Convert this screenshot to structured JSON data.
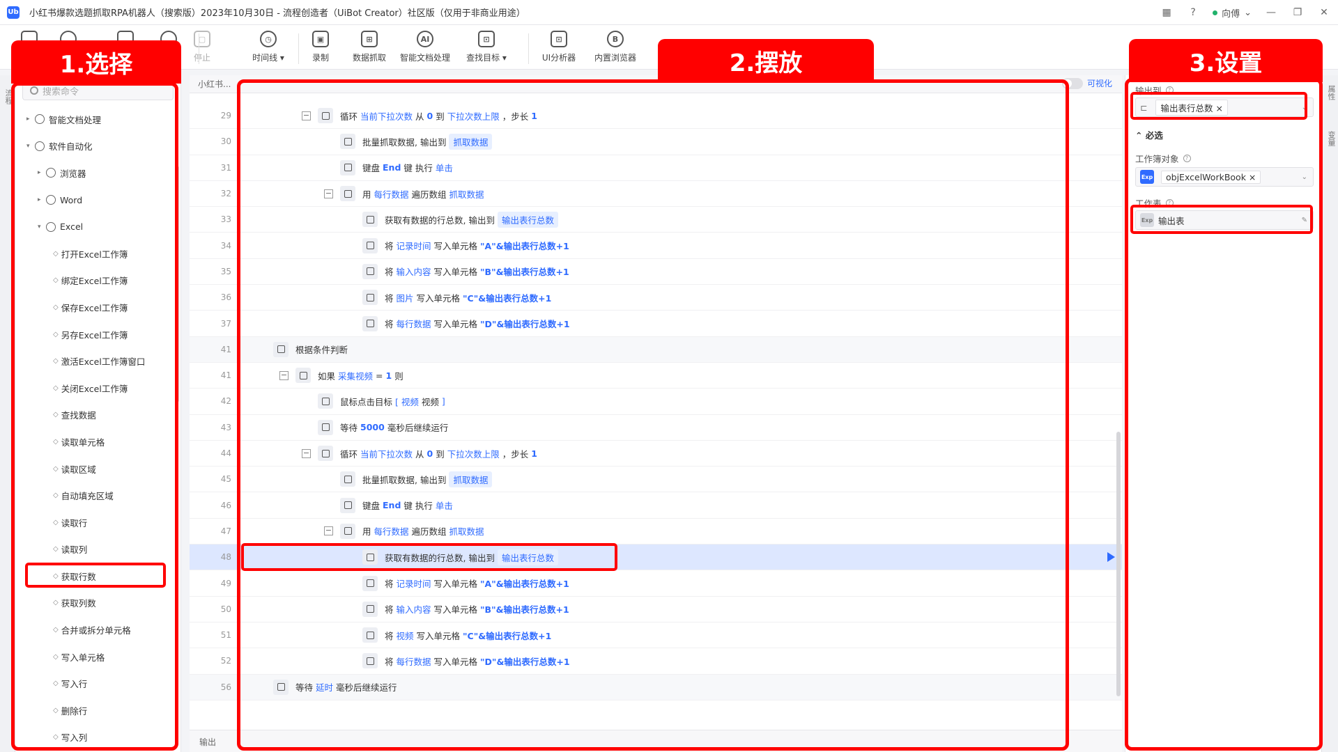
{
  "window": {
    "title": "小红书爆款选题抓取RPA机器人（搜索版）2023年10月30日 - 流程创造者（UiBot Creator）社区版（仅用于非商业用途）",
    "logo": "Ub",
    "user": "向傅"
  },
  "toolbar": {
    "items": [
      {
        "label": "停止",
        "icon": "stop-icon",
        "glyph": "▢",
        "disabled": true
      },
      {
        "label": "时间线 ▾",
        "icon": "clock-icon",
        "glyph": "◷"
      },
      {
        "label": "录制",
        "icon": "record-icon",
        "glyph": "▣"
      },
      {
        "label": "数据抓取",
        "icon": "data-scrape-icon",
        "glyph": "⊞"
      },
      {
        "label": "智能文档处理",
        "icon": "ai-doc-icon",
        "glyph": "AI"
      },
      {
        "label": "查找目标 ▾",
        "icon": "find-target-icon",
        "glyph": "⊡"
      },
      {
        "label": "UI分析器",
        "icon": "ui-analyzer-icon",
        "glyph": "⊡"
      },
      {
        "label": "内置浏览器",
        "icon": "browser-icon",
        "glyph": "B"
      }
    ]
  },
  "left": {
    "search_placeholder": "搜索命令",
    "gutter_label": "流程",
    "items": [
      {
        "label": "智能文档处理",
        "level": 0,
        "arrow": "▸"
      },
      {
        "label": "软件自动化",
        "level": 0,
        "arrow": "▾"
      },
      {
        "label": "浏览器",
        "level": 1,
        "arrow": "▸"
      },
      {
        "label": "Word",
        "level": 1,
        "arrow": "▸"
      },
      {
        "label": "Excel",
        "level": 1,
        "arrow": "▾"
      },
      {
        "label": "打开Excel工作簿",
        "level": 2
      },
      {
        "label": "绑定Excel工作簿",
        "level": 2
      },
      {
        "label": "保存Excel工作簿",
        "level": 2
      },
      {
        "label": "另存Excel工作簿",
        "level": 2
      },
      {
        "label": "激活Excel工作簿窗口",
        "level": 2
      },
      {
        "label": "关闭Excel工作簿",
        "level": 2
      },
      {
        "label": "查找数据",
        "level": 2
      },
      {
        "label": "读取单元格",
        "level": 2
      },
      {
        "label": "读取区域",
        "level": 2
      },
      {
        "label": "自动填充区域",
        "level": 2
      },
      {
        "label": "读取行",
        "level": 2
      },
      {
        "label": "读取列",
        "level": 2
      },
      {
        "label": "获取行数",
        "level": 2
      },
      {
        "label": "获取列数",
        "level": 2
      },
      {
        "label": "合并或拆分单元格",
        "level": 2
      },
      {
        "label": "写入单元格",
        "level": 2
      },
      {
        "label": "写入行",
        "level": 2
      },
      {
        "label": "删除行",
        "level": 2
      },
      {
        "label": "写入列",
        "level": 2
      }
    ]
  },
  "editor": {
    "breadcrumb": "小红书...",
    "visualize_label": "可视化",
    "bottom_tab": "输出",
    "lines": [
      {
        "n": "29",
        "indent": 2,
        "collapse": true,
        "parts": [
          [
            "t",
            "循环 "
          ],
          [
            "kw",
            "当前下拉次数"
          ],
          [
            "t",
            " 从 "
          ],
          [
            "str",
            "0"
          ],
          [
            "t",
            " 到 "
          ],
          [
            "kw",
            "下拉次数上限"
          ],
          [
            "t",
            " ，步长 "
          ],
          [
            "str",
            "1"
          ]
        ]
      },
      {
        "n": "30",
        "indent": 3,
        "parts": [
          [
            "t",
            "批量抓取数据, 输出到 "
          ],
          [
            "pill",
            "抓取数据"
          ]
        ]
      },
      {
        "n": "31",
        "indent": 3,
        "parts": [
          [
            "t",
            "键盘 "
          ],
          [
            "str",
            "End"
          ],
          [
            "t",
            " 键 执行 "
          ],
          [
            "kw",
            "单击"
          ]
        ]
      },
      {
        "n": "32",
        "indent": 3,
        "collapse": true,
        "parts": [
          [
            "t",
            "用 "
          ],
          [
            "kw",
            "每行数据"
          ],
          [
            "t",
            " 遍历数组 "
          ],
          [
            "kw",
            "抓取数据"
          ]
        ]
      },
      {
        "n": "33",
        "indent": 4,
        "parts": [
          [
            "t",
            "获取有数据的行总数, 输出到 "
          ],
          [
            "pill",
            "输出表行总数"
          ]
        ]
      },
      {
        "n": "34",
        "indent": 4,
        "parts": [
          [
            "t",
            "将 "
          ],
          [
            "kw",
            "记录时间"
          ],
          [
            "t",
            " 写入单元格 "
          ],
          [
            "str",
            "\"A\"&输出表行总数+1"
          ]
        ]
      },
      {
        "n": "35",
        "indent": 4,
        "parts": [
          [
            "t",
            "将 "
          ],
          [
            "kw",
            "输入内容"
          ],
          [
            "t",
            " 写入单元格 "
          ],
          [
            "str",
            "\"B\"&输出表行总数+1"
          ]
        ]
      },
      {
        "n": "36",
        "indent": 4,
        "parts": [
          [
            "t",
            "将 "
          ],
          [
            "kw",
            "图片"
          ],
          [
            "t",
            " 写入单元格 "
          ],
          [
            "str",
            "\"C\"&输出表行总数+1"
          ]
        ]
      },
      {
        "n": "37",
        "indent": 4,
        "parts": [
          [
            "t",
            "将 "
          ],
          [
            "kw",
            "每行数据"
          ],
          [
            "t",
            " 写入单元格 "
          ],
          [
            "str",
            "\"D\"&输出表行总数+1"
          ]
        ]
      },
      {
        "n": "41",
        "indent": 0,
        "band": true,
        "parts": [
          [
            "t",
            "根据条件判断"
          ]
        ]
      },
      {
        "n": "41",
        "indent": 1,
        "collapse": true,
        "parts": [
          [
            "t",
            "如果 "
          ],
          [
            "kw",
            "采集视频"
          ],
          [
            "t",
            " = "
          ],
          [
            "str",
            "1"
          ],
          [
            "t",
            " 则"
          ]
        ]
      },
      {
        "n": "42",
        "indent": 2,
        "parts": [
          [
            "t",
            "鼠标点击目标 "
          ],
          [
            "kw",
            "[ 视频"
          ],
          [
            "t",
            "  视频  "
          ],
          [
            "kw",
            "]"
          ]
        ]
      },
      {
        "n": "43",
        "indent": 2,
        "parts": [
          [
            "t",
            "等待 "
          ],
          [
            "str",
            "5000"
          ],
          [
            "t",
            " 毫秒后继续运行"
          ]
        ]
      },
      {
        "n": "44",
        "indent": 2,
        "collapse": true,
        "parts": [
          [
            "t",
            "循环 "
          ],
          [
            "kw",
            "当前下拉次数"
          ],
          [
            "t",
            " 从 "
          ],
          [
            "str",
            "0"
          ],
          [
            "t",
            " 到 "
          ],
          [
            "kw",
            "下拉次数上限"
          ],
          [
            "t",
            " ，步长 "
          ],
          [
            "str",
            "1"
          ]
        ]
      },
      {
        "n": "45",
        "indent": 3,
        "parts": [
          [
            "t",
            "批量抓取数据, 输出到 "
          ],
          [
            "pill",
            "抓取数据"
          ]
        ]
      },
      {
        "n": "46",
        "indent": 3,
        "parts": [
          [
            "t",
            "键盘 "
          ],
          [
            "str",
            "End"
          ],
          [
            "t",
            " 键 执行 "
          ],
          [
            "kw",
            "单击"
          ]
        ]
      },
      {
        "n": "47",
        "indent": 3,
        "collapse": true,
        "parts": [
          [
            "t",
            "用 "
          ],
          [
            "kw",
            "每行数据"
          ],
          [
            "t",
            " 遍历数组 "
          ],
          [
            "kw",
            "抓取数据"
          ]
        ]
      },
      {
        "n": "48",
        "indent": 4,
        "selected": true,
        "parts": [
          [
            "t",
            "获取有数据的行总数, 输出到 "
          ],
          [
            "pill",
            "输出表行总数"
          ]
        ]
      },
      {
        "n": "49",
        "indent": 4,
        "parts": [
          [
            "t",
            "将 "
          ],
          [
            "kw",
            "记录时间"
          ],
          [
            "t",
            " 写入单元格 "
          ],
          [
            "str",
            "\"A\"&输出表行总数+1"
          ]
        ]
      },
      {
        "n": "50",
        "indent": 4,
        "parts": [
          [
            "t",
            "将 "
          ],
          [
            "kw",
            "输入内容"
          ],
          [
            "t",
            " 写入单元格 "
          ],
          [
            "str",
            "\"B\"&输出表行总数+1"
          ]
        ]
      },
      {
        "n": "51",
        "indent": 4,
        "parts": [
          [
            "t",
            "将 "
          ],
          [
            "kw",
            "视频"
          ],
          [
            "t",
            " 写入单元格 "
          ],
          [
            "str",
            "\"C\"&输出表行总数+1"
          ]
        ]
      },
      {
        "n": "52",
        "indent": 4,
        "parts": [
          [
            "t",
            "将 "
          ],
          [
            "kw",
            "每行数据"
          ],
          [
            "t",
            " 写入单元格 "
          ],
          [
            "str",
            "\"D\"&输出表行总数+1"
          ]
        ]
      },
      {
        "n": "56",
        "indent": 0,
        "band": true,
        "parts": [
          [
            "t",
            "等待 "
          ],
          [
            "kw",
            "延时"
          ],
          [
            "t",
            " 毫秒后继续运行"
          ]
        ]
      }
    ]
  },
  "right": {
    "gutter_label": "属性",
    "gutter_label2": "变量",
    "output_label": "输出到",
    "output_value": "输出表行总数",
    "required_section": "必选",
    "workbook_label": "工作簿对象",
    "workbook_tag": "Exp",
    "workbook_value": "objExcelWorkBook",
    "sheet_label": "工作表",
    "sheet_tag": "Exp",
    "sheet_value": "输出表"
  },
  "annotations": {
    "select": "1.选择",
    "place": "2.摆放",
    "settings": "3.设置",
    "color": "#ff0000"
  }
}
